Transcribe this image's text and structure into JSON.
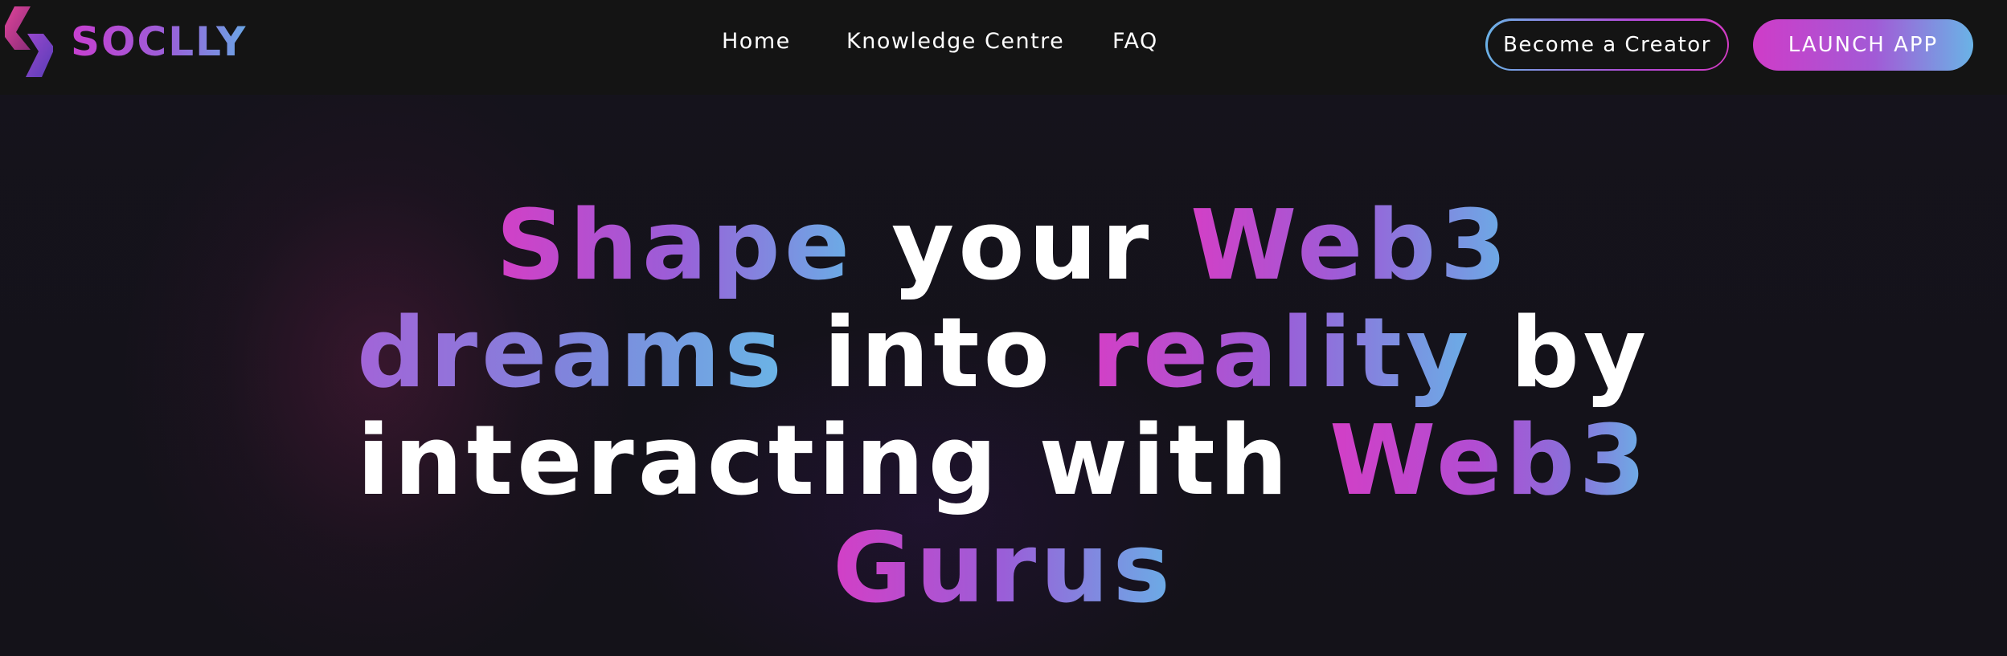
{
  "brand": {
    "name": "SOCLLY",
    "logo_icon": "soclly-logo-icon"
  },
  "nav": {
    "items": [
      {
        "label": "Home"
      },
      {
        "label": "Knowledge Centre"
      },
      {
        "label": "FAQ"
      }
    ],
    "become_creator_label": "Become a Creator",
    "launch_app_label": "LAUNCH APP"
  },
  "hero": {
    "line1": {
      "w1": "Shape",
      "w2": "your",
      "w3": "Web3"
    },
    "line2": {
      "w1": "dreams",
      "w2": "into",
      "w3": "reality",
      "w4": "by"
    },
    "line3": {
      "w1": "interacting",
      "w2": "with",
      "w3": "Web3"
    },
    "line4": {
      "w1": "Gurus"
    }
  },
  "colors": {
    "background": "#141219",
    "navbar": "#141414",
    "gradient_pink": "#d33fc6",
    "gradient_purple": "#9a5ed8",
    "gradient_blue": "#6aaee6",
    "text": "#ffffff"
  }
}
